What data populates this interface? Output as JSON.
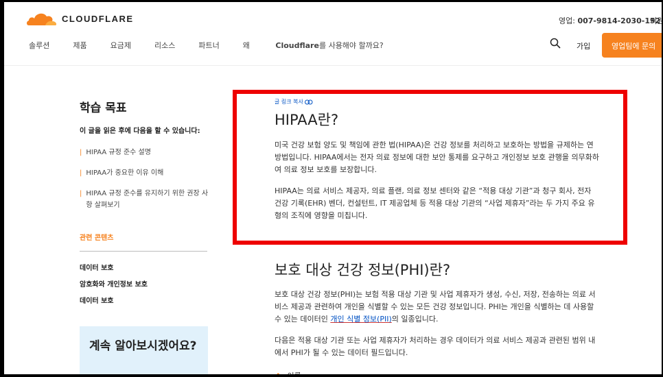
{
  "header": {
    "brand": "CLOUDFLARE",
    "sales_label": "영업:",
    "sales_phone": "007-9814-2030-192",
    "support": "지원",
    "nav": [
      "솔루션",
      "제품",
      "요금제",
      "리소스",
      "파트너"
    ],
    "nav_why_prefix": "왜 ",
    "nav_why_brand": "Cloudflare",
    "nav_why_suffix": "를 사용해야 할까요?",
    "signup": "가입",
    "cta": "영업팀에 문의"
  },
  "sidebar": {
    "title": "학습 목표",
    "lead": "이 글을 읽은 후에 다음을 할 수 있습니다:",
    "goals": [
      "HIPAA 규정 준수 설명",
      "HIPAA가 중요한 이유 이해",
      "HIPAA 규정 준수를 유지하기 위한 권장 사항 살펴보기"
    ],
    "related_title": "관련 콘텐츠",
    "related": [
      "데이터 보호",
      "암호화와 개인정보 보호",
      "데이터 보호"
    ],
    "promo": "계속 알아보시겠어요?"
  },
  "article": {
    "copy_link": "글 링크 복사",
    "h1": "HIPAA란?",
    "p1": "미국 건강 보험 양도 및 책임에 관한 법(HIPAA)은 건강 정보를 처리하고 보호하는 방법을 규제하는 연방법입니다. HIPAA에서는 전자 의료 정보에 대한 보안 통제를 요구하고 개인정보 보호 관행을 의무화하여 의료 정보 보호를 보장합니다.",
    "p2": "HIPAA는 의료 서비스 제공자, 의료 플랜, 의료 정보 센터와 같은 “적용 대상 기관”과 청구 회사, 전자 건강 기록(EHR) 벤더, 컨설턴트, IT 제공업체 등 적용 대상 기관의 “사업 제휴자”라는 두 가지 주요 유형의 조직에 영향을 미칩니다.",
    "h2": "보호 대상 건강 정보(PHI)란?",
    "p3_before": "보호 대상 건강 정보(PHI)는 보험 적용 대상 기관 및 사업 제휴자가 생성, 수신, 저장, 전송하는 의료 서비스 제공과 관련하여 개인을 식별할 수 있는 모든 건강 정보입니다. PHI는 개인을 식별하는 데 사용할 수 있는 데이터인 ",
    "p3_link": "개인 식별 정보(PII)",
    "p3_after": "의 일종입니다.",
    "p4": "다음은 적용 대상 기관 또는 사업 제휴자가 처리하는 경우 데이터가 의료 서비스 제공과 관련된 범위 내에서 PHI가 될 수 있는 데이터 필드입니다.",
    "list": [
      "이름"
    ]
  },
  "colors": {
    "accent": "#f6821f",
    "link": "#0051c3",
    "highlight": "#ee0000",
    "promo_bg": "#e1f1fb"
  }
}
